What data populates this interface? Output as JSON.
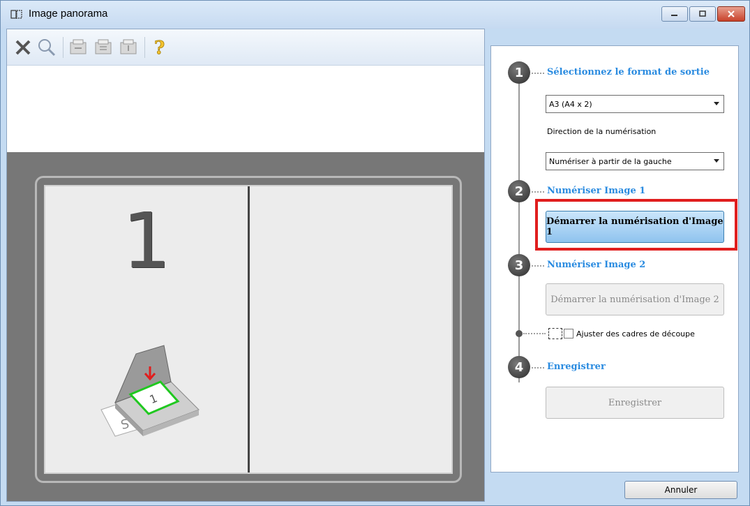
{
  "window": {
    "title": "Image panorama",
    "controls": {
      "minimize": "minimize-icon",
      "maximize": "maximize-icon",
      "close": "close-icon"
    }
  },
  "toolbar": {
    "items": [
      {
        "name": "delete-icon"
      },
      {
        "name": "zoom-icon"
      },
      {
        "name": "rotate-left-icon"
      },
      {
        "name": "rotate-right-icon"
      },
      {
        "name": "flip-icon"
      },
      {
        "name": "help-icon"
      }
    ]
  },
  "preview": {
    "slot_number": "1"
  },
  "steps": {
    "step1": {
      "number": "1",
      "label": "Sélectionnez le format de sortie",
      "output_format": "A3 (A4 x 2)",
      "direction_label": "Direction de la numérisation",
      "direction_value": "Numériser à partir de la gauche"
    },
    "step2": {
      "number": "2",
      "label": "Numériser Image 1",
      "button": "Démarrer la numérisation d'Image 1"
    },
    "step3": {
      "number": "3",
      "label": "Numériser Image 2",
      "button": "Démarrer la numérisation d'Image 2",
      "crop_label": "Ajuster des cadres de découpe"
    },
    "step4": {
      "number": "4",
      "label": "Enregistrer",
      "button": "Enregistrer"
    }
  },
  "footer": {
    "cancel": "Annuler"
  },
  "colors": {
    "accent": "#2a8be0",
    "highlight": "#e01e1e",
    "chrome": "#c4dbf2"
  }
}
